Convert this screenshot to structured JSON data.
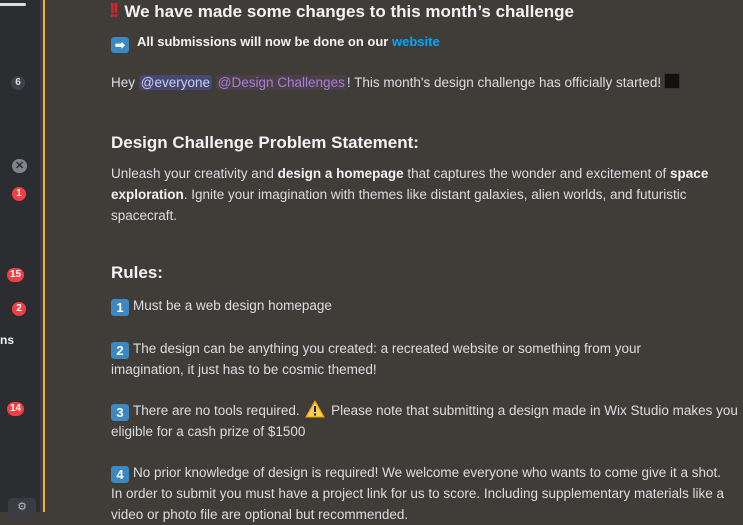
{
  "sidebar": {
    "badges": [
      "6",
      "✕",
      "1",
      "15",
      "2",
      "14"
    ],
    "partial_label": "ns",
    "bottom_icon": "channel-settings-icon"
  },
  "message": {
    "headline": "We have made some changes to this month’s challenge",
    "headline_emoji": "!!",
    "subline_prefix": "All submissions will now be done on our",
    "subline_link": "website",
    "greeting_start": "Hey",
    "mention_everyone": "@everyone",
    "mention_role": "@Design Challenges",
    "greeting_end": "! This month's design challenge has officially started!",
    "section_problem": "Design Challenge Problem Statement:",
    "problem_1": "Unleash your creativity and ",
    "problem_bold_1": "design a homepage",
    "problem_2": " that captures the wonder and excitement of ",
    "problem_bold_2": "space exploration",
    "problem_3": ". Ignite your imagination with themes like distant galaxies, alien worlds, and futuristic spacecraft.",
    "section_rules": "Rules:",
    "rules": [
      {
        "num": "1",
        "text": "Must be a web design homepage"
      },
      {
        "num": "2",
        "text": "The design can be anything you created: a recreated website or something from your imagination, it just has to be cosmic themed!"
      },
      {
        "num": "3",
        "text_a": "There are no tools required.",
        "text_b": "Please note that submitting a design made in Wix Studio makes you eligible for a cash prize of $1500"
      },
      {
        "num": "4",
        "text": "No prior knowledge of design is required! We welcome everyone who wants to come give it a shot. In order to submit you must have a project link for us to score. Including supplementary materials like a video or photo file are optional but recommended."
      }
    ]
  }
}
